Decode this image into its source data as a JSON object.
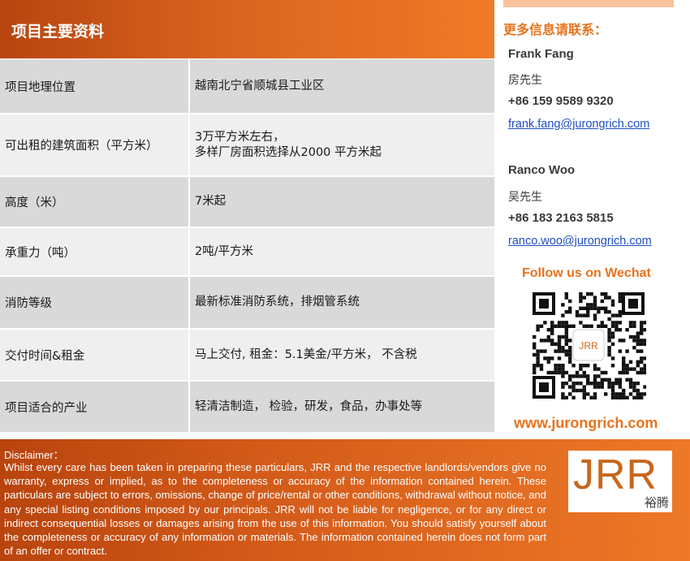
{
  "title": "项目主要资料",
  "table": {
    "rows": [
      {
        "label": "项目地理位置",
        "value_lines": [
          "越南北宁省顺城县工业区"
        ]
      },
      {
        "label": "可出租的建筑面积（平方米）",
        "value_lines": [
          "3万平方米左右，",
          "多样厂房面积选择从2000 平方米起"
        ]
      },
      {
        "label": "高度（米）",
        "value_lines": [
          "7米起"
        ]
      },
      {
        "label": "承重力（吨）",
        "value_lines": [
          "2吨/平方米"
        ]
      },
      {
        "label": "消防等级",
        "value_lines": [
          "最新标准消防系统，排烟管系统"
        ]
      },
      {
        "label": "交付时间&租金",
        "value_lines": [
          "马上交付, 租金：5.1美金/平方米， 不含税"
        ]
      },
      {
        "label": "项目适合的产业",
        "value_lines": [
          "轻清洁制造，  检验，研发，食品，办事处等"
        ]
      }
    ]
  },
  "contact": {
    "heading": "更多信息请联系：",
    "people": [
      {
        "name": "Frank Fang",
        "cn_name": "房先生",
        "phone": "+86 159 9589 9320",
        "email": "frank.fang@jurongrich.com"
      },
      {
        "name": "Ranco Woo",
        "cn_name": "吴先生",
        "phone": "+86 183 2163 5815",
        "email": "ranco.woo@jurongrich.com"
      }
    ],
    "follow": "Follow us on Wechat",
    "qr_center": "JRR",
    "website": "www.jurongrich.com"
  },
  "disclaimer": {
    "heading": "Disclaimer：",
    "body": "Whilst every care has been taken in preparing these particulars, JRR and the respective landlords/vendors give no warranty, express or implied, as to the completeness or accuracy of the information contained herein. These particulars are subject to errors, omissions, change of price/rental or other conditions, withdrawal without notice, and any special listing conditions imposed by our principals. JRR will not be liable for negligence, or for any direct or indirect consequential losses or damages arising from the use of this information. You should satisfy yourself about the completeness or accuracy of any information or materials. The information contained herein does not form part of an offer or contract."
  },
  "logo": {
    "mark": "JRR",
    "cn": "裕腾"
  },
  "colors": {
    "accent": "#e8731c",
    "header_dark": "#b8450f",
    "row_shade": "#d9d9d9",
    "row_light": "#efefef",
    "link": "#1f4fbf"
  }
}
